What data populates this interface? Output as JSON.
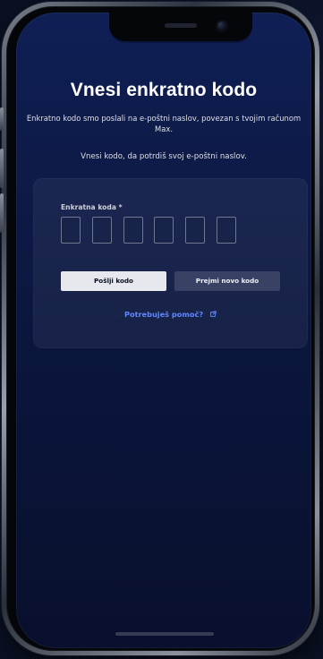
{
  "screen": {
    "title": "Vnesi enkratno kodo",
    "subtitle": "Enkratno kodo smo poslali na e-poštni naslov, povezan s tvojim računom Max.",
    "instruction": "Vnesi kodo, da potrdiš svoj e-poštni naslov."
  },
  "form": {
    "otp_label": "Enkratna koda *",
    "otp_digits": [
      "",
      "",
      "",
      "",
      "",
      ""
    ],
    "primary_button": "Pošlji kodo",
    "secondary_button": "Prejmi novo kodo",
    "help_link": "Potrebuješ pomoč?",
    "help_icon": "external-link-icon"
  },
  "colors": {
    "link": "#5f86ff",
    "primary_button_bg": "#e6e8ee",
    "secondary_button_bg": "#2a3251",
    "screen_bg_top": "#0f1f55",
    "screen_bg_bottom": "#09102d"
  }
}
